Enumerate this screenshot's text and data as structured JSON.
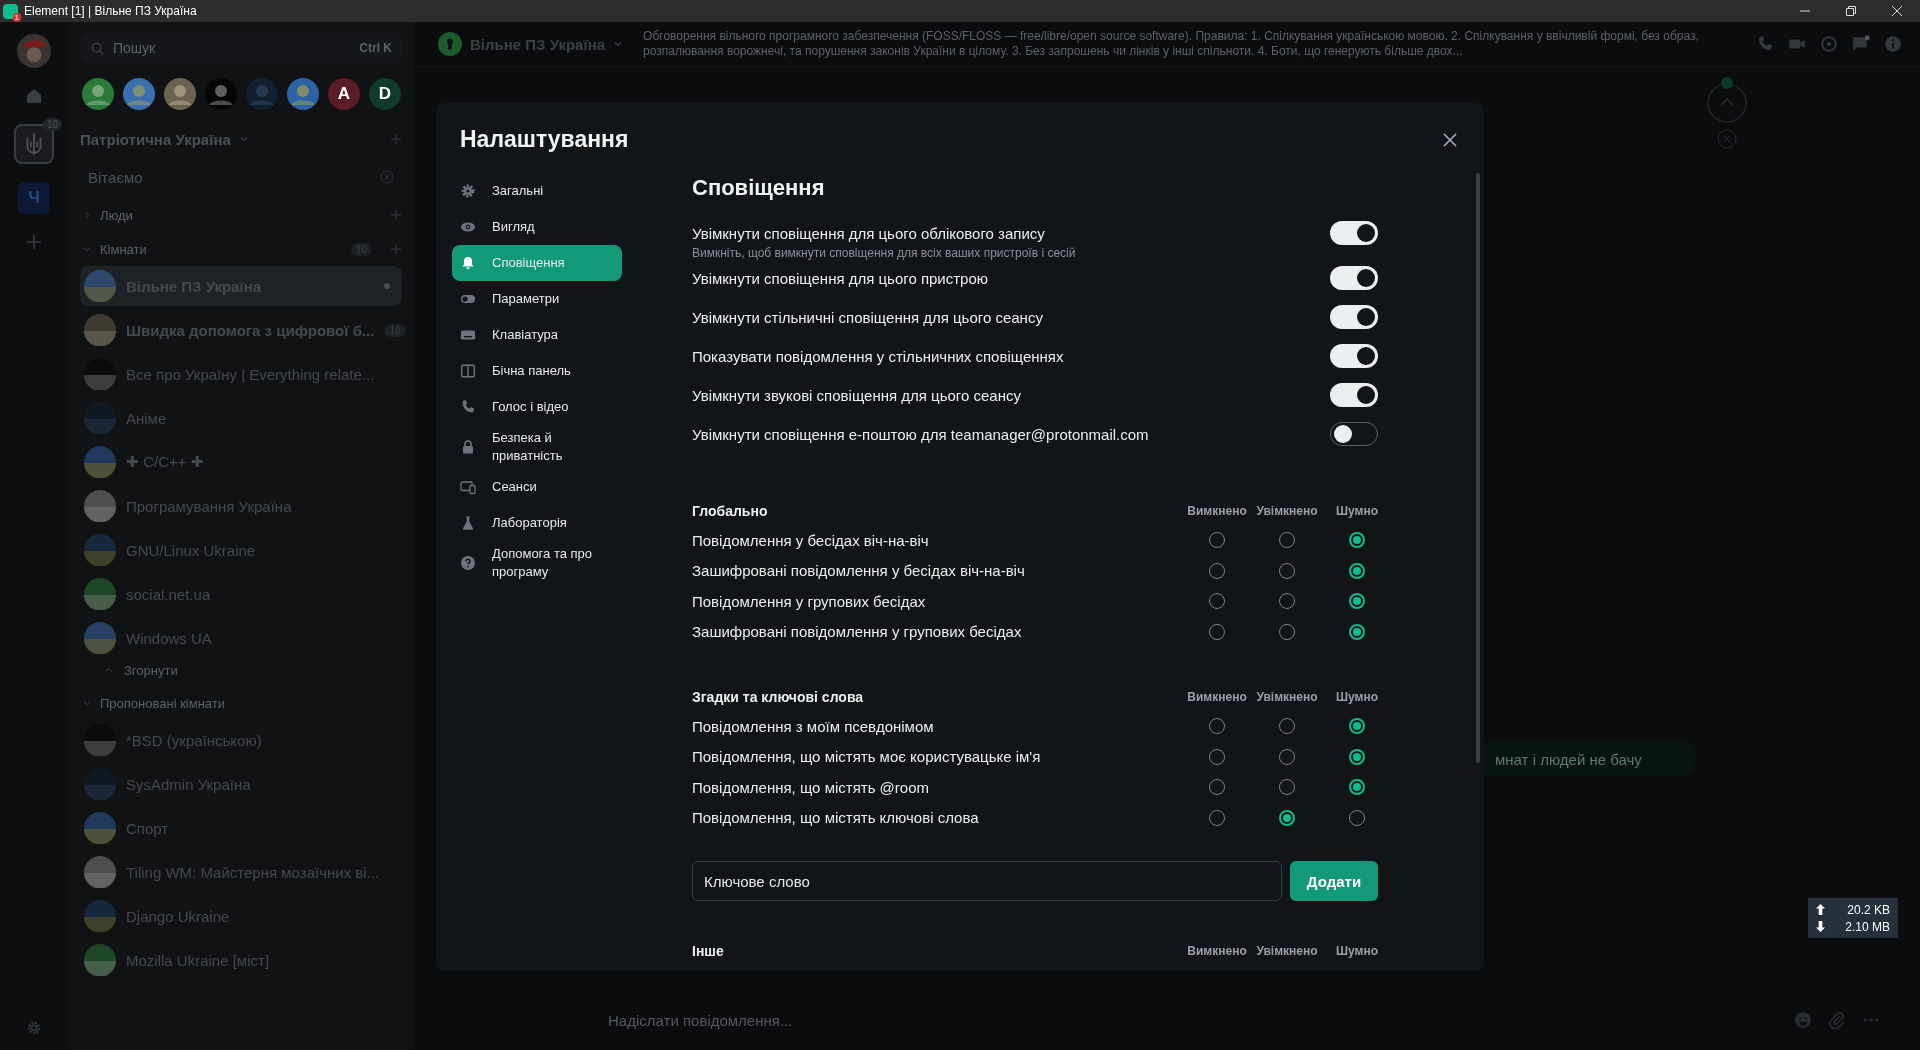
{
  "window": {
    "title": "Element [1] | Вільне ПЗ Україна",
    "app_badge": "1"
  },
  "rail": {
    "space_badge": "10",
    "space_letter": "Ч"
  },
  "search": {
    "placeholder": "Пошук",
    "shortcut": "Ctrl K"
  },
  "recent_people": [
    {
      "kind": "picture"
    },
    {
      "kind": "picture"
    },
    {
      "kind": "picture"
    },
    {
      "kind": "picture"
    },
    {
      "kind": "picture"
    },
    {
      "kind": "picture"
    },
    {
      "kind": "letter",
      "letter": "A",
      "color": "#5a1c26"
    },
    {
      "kind": "letter",
      "letter": "D",
      "color": "#103a2a"
    }
  ],
  "space": {
    "title": "Патріотична Україна",
    "welcome": "Вітаємо"
  },
  "people_section": {
    "title": "Люди"
  },
  "rooms_section": {
    "title": "Кімнати",
    "count": "10"
  },
  "rooms": [
    {
      "name": "Вільне ПЗ Україна",
      "bold": true,
      "selected": true,
      "unread_dot": true
    },
    {
      "name": "Швидка допомога з цифрової б...",
      "bold": true,
      "selected": false,
      "unread_dot": false,
      "badge": "10"
    },
    {
      "name": "Все про Україну | Everything relate...",
      "bold": false,
      "selected": false,
      "unread_dot": false
    },
    {
      "name": "Аніме",
      "bold": false,
      "selected": false,
      "unread_dot": false
    },
    {
      "name": "✚ C/C++ ✚",
      "bold": false,
      "selected": false,
      "unread_dot": false
    },
    {
      "name": "Програмування Україна",
      "bold": false,
      "selected": false,
      "unread_dot": false
    },
    {
      "name": "GNU/Linux Ukraine",
      "bold": false,
      "selected": false,
      "unread_dot": false
    },
    {
      "name": "social.net.ua",
      "bold": false,
      "selected": false,
      "unread_dot": false
    },
    {
      "name": "Windows UA",
      "bold": false,
      "selected": false,
      "unread_dot": false
    }
  ],
  "collapse_label": "Згорнути",
  "suggested": {
    "title": "Пропоновані кімнати",
    "rooms": [
      {
        "name": "*BSD (українською)"
      },
      {
        "name": "SysAdmin Україна"
      },
      {
        "name": "Спорт"
      },
      {
        "name": "Tiling WM: Майстерня мозаїчних ві..."
      },
      {
        "name": "Django Ukraine"
      },
      {
        "name": "Mozilla Ukraine [міст]"
      }
    ]
  },
  "room_header": {
    "name": "Вільне ПЗ Україна",
    "topic": "Обговорення вільного програмного забезпечення (FOSS/FLOSS — free/libre/open source software). Правила: 1. Спілкування українською мовою. 2. Спілкування у ввічливій формі, без образ, розпалювання ворожнечі, та порушення законів України в цілому. 3. Без запрошень чи лінків у інші спільноти. 4. Боти, що генерують більше двох..."
  },
  "message_fragment": "мнат і людей не бачу",
  "composer": {
    "placeholder": "Надіслати повідомлення..."
  },
  "net_speed": {
    "upload": "20.2 KB",
    "download": "2.10 MB"
  },
  "settings": {
    "title": "Налаштування",
    "nav": [
      {
        "label": "Загальні",
        "selected": false
      },
      {
        "label": "Вигляд",
        "selected": false
      },
      {
        "label": "Сповіщення",
        "selected": true
      },
      {
        "label": "Параметри",
        "selected": false
      },
      {
        "label": "Клавіатура",
        "selected": false
      },
      {
        "label": "Бічна панель",
        "selected": false
      },
      {
        "label": "Голос і відео",
        "selected": false
      },
      {
        "label": "Безпека й приватність",
        "selected": false
      },
      {
        "label": "Сеанси",
        "selected": false
      },
      {
        "label": "Лабораторія",
        "selected": false
      },
      {
        "label": "Допомога та про програму",
        "selected": false
      }
    ],
    "heading": "Сповіщення",
    "toggles": [
      {
        "label": "Увімкнути сповіщення для цього облікового запису",
        "description": "Вимкніть, щоб вимкнути сповіщення для всіх ваших пристроїв і сесій",
        "on": true
      },
      {
        "label": "Увімкнути сповіщення для цього пристрою",
        "on": true
      },
      {
        "label": "Увімкнути стільничні сповіщення для цього сеансу",
        "on": true
      },
      {
        "label": "Показувати повідомлення у стільничних сповіщеннях",
        "on": true
      },
      {
        "label": "Увімкнути звукові сповіщення для цього сеансу",
        "on": true
      },
      {
        "label": "Увімкнути сповіщення е-поштою для teamanager@protonmail.com",
        "on": false
      }
    ],
    "groups": [
      {
        "title": "Глобально",
        "columns": [
          "Вимкнено",
          "Увімкнено",
          "Шумно"
        ],
        "rows": [
          {
            "label": "Повідомлення у бесідах віч-на-віч",
            "options": [
              {
                "selected": false
              },
              {
                "selected": false
              },
              {
                "selected": true
              }
            ]
          },
          {
            "label": "Зашифровані повідомлення у бесідах віч-на-віч",
            "options": [
              {
                "selected": false
              },
              {
                "selected": false
              },
              {
                "selected": true
              }
            ]
          },
          {
            "label": "Повідомлення у групових бесідах",
            "options": [
              {
                "selected": false
              },
              {
                "selected": false
              },
              {
                "selected": true
              }
            ]
          },
          {
            "label": "Зашифровані повідомлення у групових бесідах",
            "options": [
              {
                "selected": false
              },
              {
                "selected": false
              },
              {
                "selected": true
              }
            ]
          }
        ]
      },
      {
        "title": "Згадки та ключові слова",
        "columns": [
          "Вимкнено",
          "Увімкнено",
          "Шумно"
        ],
        "rows": [
          {
            "label": "Повідомлення з моїм псевдонімом",
            "options": [
              {
                "selected": false
              },
              {
                "selected": false
              },
              {
                "selected": true
              }
            ]
          },
          {
            "label": "Повідомлення, що містять моє користувацьке ім'я",
            "options": [
              {
                "selected": false
              },
              {
                "selected": false
              },
              {
                "selected": true
              }
            ]
          },
          {
            "label": "Повідомлення, що містять @room",
            "options": [
              {
                "selected": false
              },
              {
                "selected": false
              },
              {
                "selected": true
              }
            ]
          },
          {
            "label": "Повідомлення, що містять ключові слова",
            "options": [
              {
                "selected": false
              },
              {
                "selected": true
              },
              {
                "selected": false
              }
            ]
          }
        ],
        "keyword_field": {
          "placeholder": "Ключове слово"
        },
        "add_button": "Додати"
      },
      {
        "title": "Інше",
        "columns": [
          "Вимкнено",
          "Увімкнено",
          "Шумно"
        ]
      }
    ]
  }
}
